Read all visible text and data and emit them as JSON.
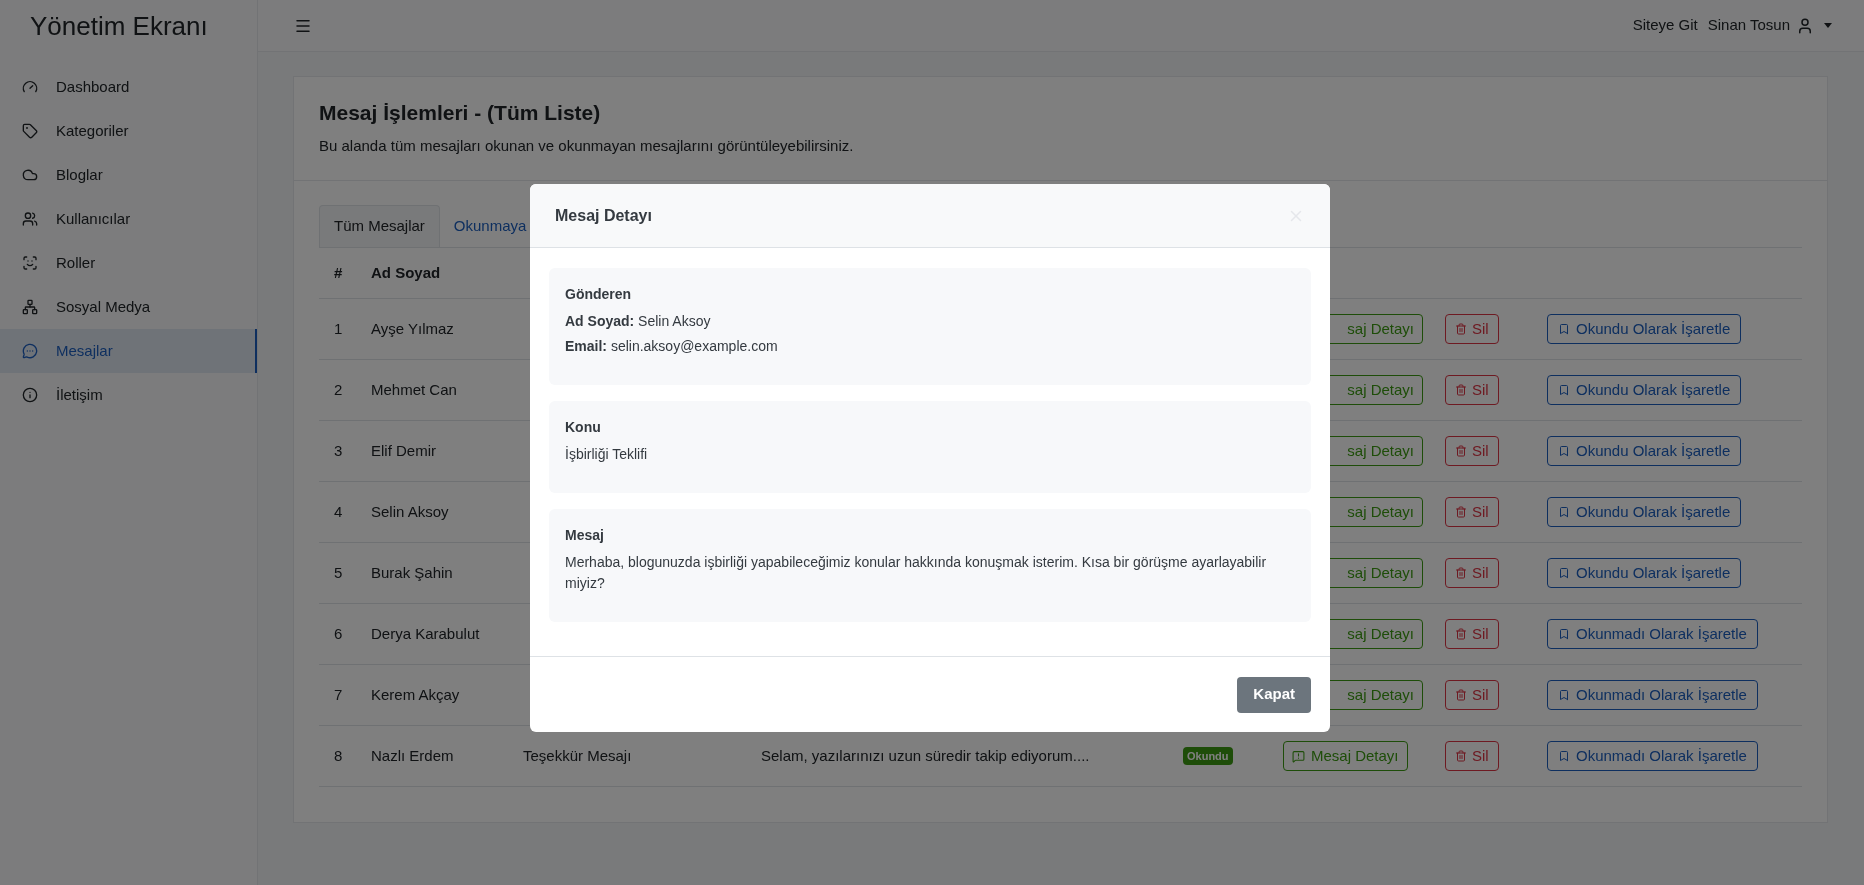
{
  "sidebar": {
    "title": "Yönetim Ekranı",
    "items": [
      {
        "label": "Dashboard",
        "selected": false
      },
      {
        "label": "Kategoriler",
        "selected": false
      },
      {
        "label": "Bloglar",
        "selected": false
      },
      {
        "label": "Kullanıcılar",
        "selected": false
      },
      {
        "label": "Roller",
        "selected": false
      },
      {
        "label": "Sosyal Medya",
        "selected": false
      },
      {
        "label": "Mesajlar",
        "selected": true
      },
      {
        "label": "İletişim",
        "selected": false
      }
    ]
  },
  "topbar": {
    "link": "Siteye Git",
    "user": "Sinan Tosun"
  },
  "page": {
    "title": "Mesaj İşlemleri - (Tüm Liste)",
    "subtitle": "Bu alanda tüm mesajları okunan ve okunmayan mesajlarını görüntüleyebilirsiniz.",
    "tabs": [
      {
        "label": "Tüm Mesajlar",
        "selected": true
      },
      {
        "label": "Okunmaya",
        "selected": false
      }
    ],
    "table": {
      "columns": [
        "#",
        "Ad Soyad"
      ],
      "rows": [
        {
          "no": "1",
          "name": "Ayşe Yılmaz",
          "detail": "saj Detayı",
          "delete": "Sil",
          "mark": "Okundu Olarak İşaretle"
        },
        {
          "no": "2",
          "name": "Mehmet Can",
          "detail": "saj Detayı",
          "delete": "Sil",
          "mark": "Okundu Olarak İşaretle"
        },
        {
          "no": "3",
          "name": "Elif Demir",
          "detail": "saj Detayı",
          "delete": "Sil",
          "mark": "Okundu Olarak İşaretle"
        },
        {
          "no": "4",
          "name": "Selin Aksoy",
          "detail": "saj Detayı",
          "delete": "Sil",
          "mark": "Okundu Olarak İşaretle"
        },
        {
          "no": "5",
          "name": "Burak Şahin",
          "detail": "saj Detayı",
          "delete": "Sil",
          "mark": "Okundu Olarak İşaretle"
        },
        {
          "no": "6",
          "name": "Derya Karabulut",
          "detail": "saj Detayı",
          "delete": "Sil",
          "mark": "Okunmadı Olarak İşaretle"
        },
        {
          "no": "7",
          "name": "Kerem Akçay",
          "detail": "saj Detayı",
          "delete": "Sil",
          "mark": "Okunmadı Olarak İşaretle"
        },
        {
          "no": "8",
          "name": "Nazlı Erdem",
          "subject": "Teşekkür Mesajı",
          "message": "Selam, yazılarınızı uzun süredir takip ediyorum....",
          "status": {
            "label": "Okundu",
            "read": true
          },
          "detail": "Mesaj Detayı",
          "delete": "Sil",
          "mark": "Okunmadı Olarak İşaretle"
        }
      ]
    }
  },
  "modal": {
    "title": "Mesaj Detayı",
    "sections": [
      {
        "heading": "Gönderen",
        "lines": [
          "**Ad Soyad:** Selin Aksoy",
          "**Email:** selin.aksoy@example.com"
        ]
      },
      {
        "heading": "Konu",
        "lines": [
          "İşbirliği Teklifi"
        ]
      },
      {
        "heading": "Mesaj",
        "lines": [
          "Merhaba, blogunuzda işbirliği yapabileceğimiz konular hakkında konuşmak isterim. Kısa bir görüşme ayarlayabilir miyiz?"
        ]
      }
    ],
    "button": "Kapat"
  }
}
